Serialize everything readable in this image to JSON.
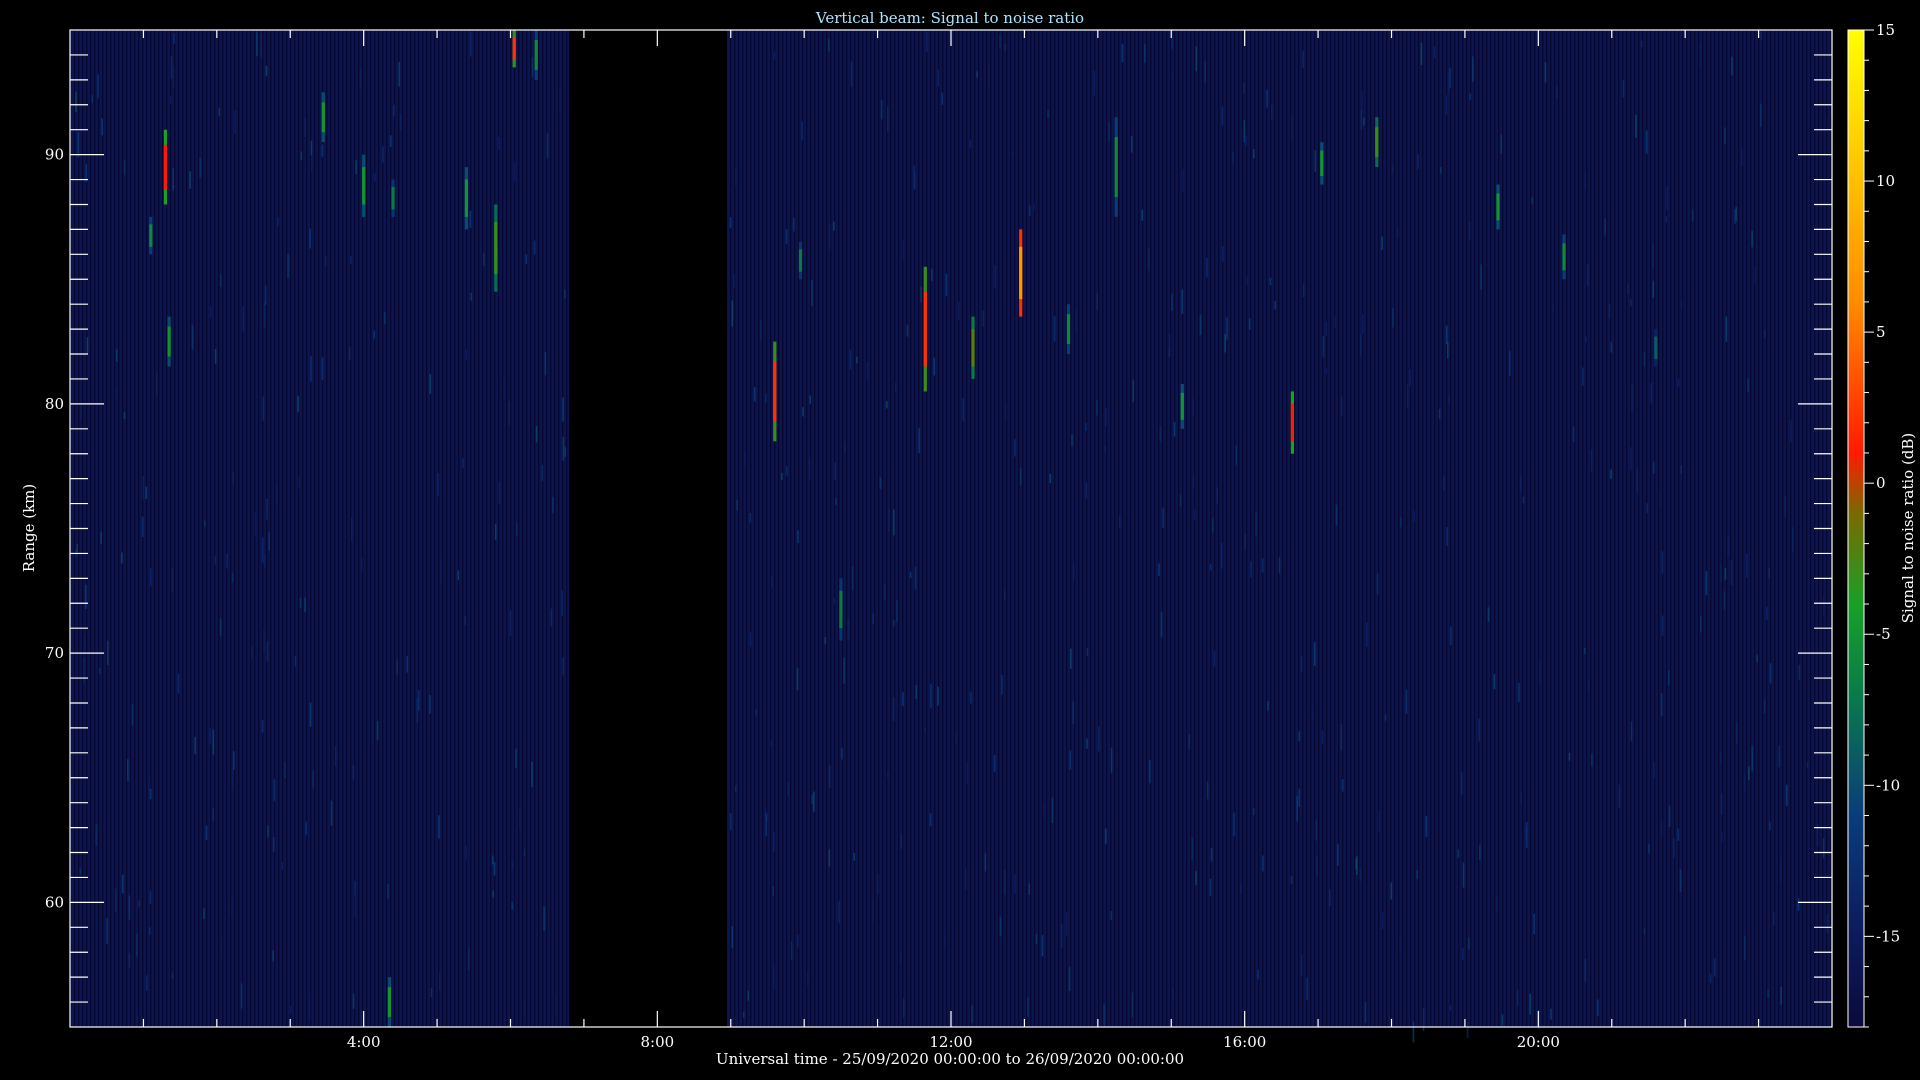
{
  "chart_data": {
    "type": "heatmap",
    "title": "Vertical beam: Signal to noise ratio",
    "xlabel": "Universal time - 25/09/2020 00:00:00 to 26/09/2020 00:00:00",
    "ylabel": "Range (km)",
    "colorbar_label": "Signal to noise ratio (dB)",
    "xlim": [
      0,
      24
    ],
    "ylim": [
      55,
      95
    ],
    "x_ticks": [
      {
        "value": 4,
        "label": "4:00"
      },
      {
        "value": 8,
        "label": "8:00"
      },
      {
        "value": 12,
        "label": "12:00"
      },
      {
        "value": 16,
        "label": "16:00"
      },
      {
        "value": 20,
        "label": "20:00"
      }
    ],
    "y_ticks": [
      {
        "value": 60,
        "label": "60"
      },
      {
        "value": 70,
        "label": "70"
      },
      {
        "value": 80,
        "label": "80"
      },
      {
        "value": 90,
        "label": "90"
      }
    ],
    "colorbar_range": [
      -18,
      15
    ],
    "colorbar_ticks": [
      {
        "value": 15,
        "label": "15"
      },
      {
        "value": 10,
        "label": "10"
      },
      {
        "value": 5,
        "label": "5"
      },
      {
        "value": 0,
        "label": "0"
      },
      {
        "value": -5,
        "label": "-5"
      },
      {
        "value": -10,
        "label": "-10"
      },
      {
        "value": -15,
        "label": "-15"
      }
    ],
    "colormap_stops": [
      {
        "value": -18,
        "color": "#0a0a3c"
      },
      {
        "value": -15,
        "color": "#0d1a5a"
      },
      {
        "value": -11,
        "color": "#0a3c7a"
      },
      {
        "value": -7,
        "color": "#0a7a4a"
      },
      {
        "value": -4,
        "color": "#18a028"
      },
      {
        "value": -1,
        "color": "#7a6a00"
      },
      {
        "value": 1,
        "color": "#ff1a00"
      },
      {
        "value": 6,
        "color": "#ff8c00"
      },
      {
        "value": 15,
        "color": "#ffff00"
      }
    ],
    "background_level_db": -16,
    "data_gap": [
      6.8,
      8.95
    ],
    "echoes": [
      {
        "t": 1.3,
        "r0": 88.0,
        "r1": 91.0,
        "snr": 1
      },
      {
        "t": 1.35,
        "r0": 81.5,
        "r1": 83.5,
        "snr": -5
      },
      {
        "t": 1.1,
        "r0": 86.0,
        "r1": 87.5,
        "snr": -6
      },
      {
        "t": 3.45,
        "r0": 90.5,
        "r1": 92.5,
        "snr": -5
      },
      {
        "t": 4.0,
        "r0": 87.5,
        "r1": 90.0,
        "snr": -5
      },
      {
        "t": 4.35,
        "r0": 55.0,
        "r1": 57.0,
        "snr": -5
      },
      {
        "t": 4.4,
        "r0": 87.5,
        "r1": 89.0,
        "snr": -7
      },
      {
        "t": 5.4,
        "r0": 87.0,
        "r1": 89.5,
        "snr": -5
      },
      {
        "t": 5.8,
        "r0": 84.5,
        "r1": 88.0,
        "snr": -3
      },
      {
        "t": 6.05,
        "r0": 93.5,
        "r1": 95.0,
        "snr": 2
      },
      {
        "t": 6.35,
        "r0": 93.0,
        "r1": 95.0,
        "snr": -6
      },
      {
        "t": 9.6,
        "r0": 78.5,
        "r1": 82.5,
        "snr": 2
      },
      {
        "t": 9.95,
        "r0": 85.0,
        "r1": 86.5,
        "snr": -7
      },
      {
        "t": 10.5,
        "r0": 70.5,
        "r1": 73.0,
        "snr": -7
      },
      {
        "t": 11.65,
        "r0": 80.5,
        "r1": 85.5,
        "snr": 2
      },
      {
        "t": 12.3,
        "r0": 81.0,
        "r1": 83.5,
        "snr": -2
      },
      {
        "t": 12.95,
        "r0": 83.5,
        "r1": 87.0,
        "snr": 7
      },
      {
        "t": 13.6,
        "r0": 82.0,
        "r1": 84.0,
        "snr": -6
      },
      {
        "t": 14.25,
        "r0": 87.5,
        "r1": 91.5,
        "snr": -6
      },
      {
        "t": 15.15,
        "r0": 79.0,
        "r1": 80.8,
        "snr": -5
      },
      {
        "t": 16.65,
        "r0": 78.0,
        "r1": 80.5,
        "snr": 1
      },
      {
        "t": 17.05,
        "r0": 88.8,
        "r1": 90.5,
        "snr": -5
      },
      {
        "t": 17.8,
        "r0": 89.5,
        "r1": 91.5,
        "snr": -3
      },
      {
        "t": 19.45,
        "r0": 87.0,
        "r1": 88.8,
        "snr": -5
      },
      {
        "t": 20.35,
        "r0": 85.0,
        "r1": 86.8,
        "snr": -6
      },
      {
        "t": 21.6,
        "r0": 81.5,
        "r1": 83.0,
        "snr": -9
      }
    ]
  }
}
